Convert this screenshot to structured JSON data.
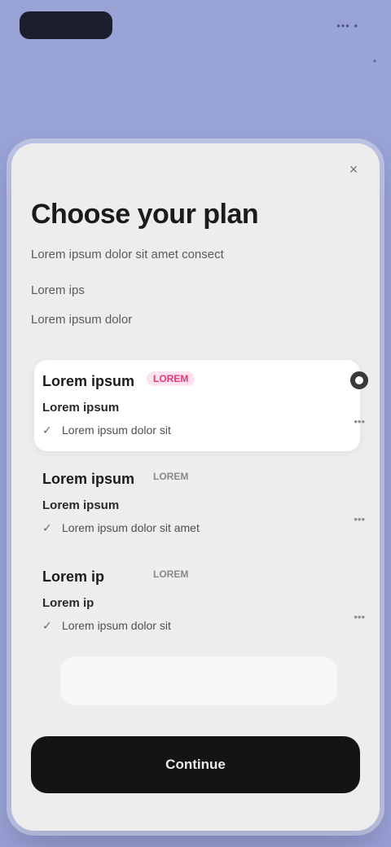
{
  "status": {
    "right_text": "••• •",
    "corner_mark": "•"
  },
  "sheet": {
    "close_glyph": "×",
    "title": "Choose your plan",
    "subtitle": "Lorem ipsum dolor sit amet consect",
    "note": "Lorem ips",
    "link": "Lorem ipsum dolor"
  },
  "plans": [
    {
      "name": "Lorem ipsum",
      "badge": "LOREM",
      "price": "Lorem ipsum",
      "feature": "Lorem ipsum dolor sit",
      "right": "•••",
      "selected": true
    },
    {
      "name": "Lorem ipsum",
      "badge": "LOREM",
      "price": "Lorem ipsum",
      "feature": "Lorem ipsum dolor sit amet",
      "right": "•••",
      "selected": false
    },
    {
      "name": "Lorem ip",
      "badge": "LOREM",
      "price": "Lorem ip",
      "feature": "Lorem ipsum dolor sit",
      "right": "•••",
      "selected": false
    }
  ],
  "check_glyph": "✓",
  "cta_label": "Continue",
  "colors": {
    "background": "#9aa3d6",
    "sheet": "#ededee",
    "badge_accent": "#e03a7a",
    "cta": "#141414"
  }
}
